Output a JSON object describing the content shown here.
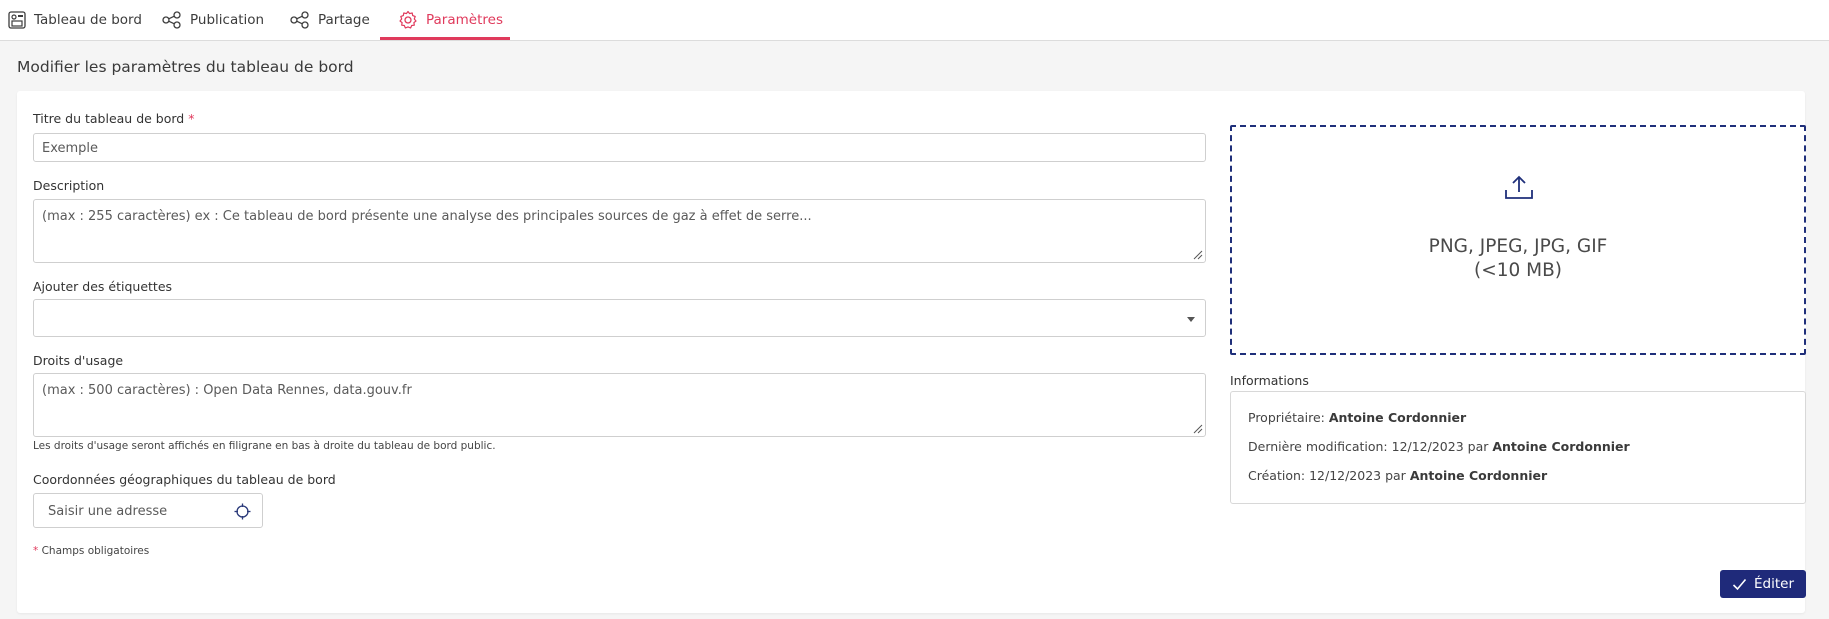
{
  "tabs": [
    {
      "label": "Tableau de bord",
      "icon": "dashboard-icon",
      "active": false
    },
    {
      "label": "Publication",
      "icon": "share-nodes-icon",
      "active": false
    },
    {
      "label": "Partage",
      "icon": "share-nodes-icon",
      "active": false
    },
    {
      "label": "Paramètres",
      "icon": "gear-icon",
      "active": true
    }
  ],
  "page": {
    "title": "Modifier les paramètres du tableau de bord"
  },
  "form": {
    "title_label": "Titre du tableau de bord",
    "required_mark": "*",
    "title_value": "Exemple",
    "description_label": "Description",
    "description_placeholder": "(max : 255 caractères) ex : Ce tableau de bord présente une analyse des principales sources de gaz à effet de serre...",
    "tags_label": "Ajouter des étiquettes",
    "tags_value": "",
    "rights_label": "Droits d'usage",
    "rights_placeholder": "(max : 500 caractères) : Open Data Rennes, data.gouv.fr",
    "rights_hint": "Les droits d'usage seront affichés en filigrane en bas à droite du tableau de bord public.",
    "geo_label": "Coordonnées géographiques du tableau de bord",
    "geo_placeholder": "Saisir une adresse",
    "required_note": "Champs obligatoires"
  },
  "upload": {
    "formats": "PNG, JPEG, JPG, GIF",
    "size_limit": "(<10 MB)"
  },
  "info": {
    "heading": "Informations",
    "owner_label": "Propriétaire: ",
    "owner_name": "Antoine Cordonnier",
    "modified_label": "Dernière modification: 12/12/2023 par ",
    "modified_name": "Antoine Cordonnier",
    "created_label": "Création: 12/12/2023 par ",
    "created_name": "Antoine Cordonnier"
  },
  "actions": {
    "edit_label": "Éditer"
  },
  "colors": {
    "accent": "#e03a5c",
    "primary": "#1f2a7a",
    "background": "#f5f5f5"
  }
}
